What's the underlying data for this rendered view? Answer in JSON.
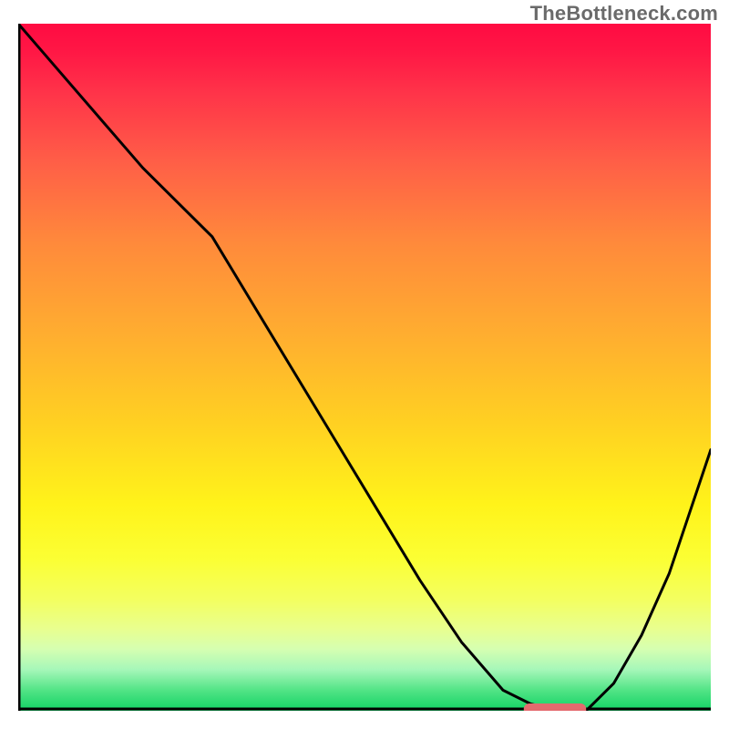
{
  "watermark": "TheBottleneck.com",
  "chart_data": {
    "type": "line",
    "title": "",
    "xlabel": "",
    "ylabel": "",
    "xlim": [
      0,
      100
    ],
    "ylim": [
      0,
      100
    ],
    "grid": false,
    "gradient": {
      "direction": "vertical",
      "stops": [
        {
          "pos": 0.0,
          "color": "#ff0b42"
        },
        {
          "pos": 0.1,
          "color": "#ff3349"
        },
        {
          "pos": 0.32,
          "color": "#ff8a3b"
        },
        {
          "pos": 0.58,
          "color": "#ffd022"
        },
        {
          "pos": 0.78,
          "color": "#fbff34"
        },
        {
          "pos": 0.94,
          "color": "#a6f7b9"
        },
        {
          "pos": 1.0,
          "color": "#11d264"
        }
      ]
    },
    "series": [
      {
        "name": "bottleneck-curve",
        "x": [
          0,
          6,
          12,
          18,
          24,
          28,
          34,
          40,
          46,
          52,
          58,
          64,
          70,
          74,
          78,
          82,
          86,
          90,
          94,
          100
        ],
        "y": [
          100,
          93,
          86,
          79,
          73,
          69,
          59,
          49,
          39,
          29,
          19,
          10,
          3,
          1,
          0,
          0,
          4,
          11,
          20,
          38
        ]
      }
    ],
    "target_marker": {
      "name": "optimal-range",
      "x_start": 73,
      "x_end": 82,
      "y": 0,
      "color": "#e46a6e"
    }
  }
}
